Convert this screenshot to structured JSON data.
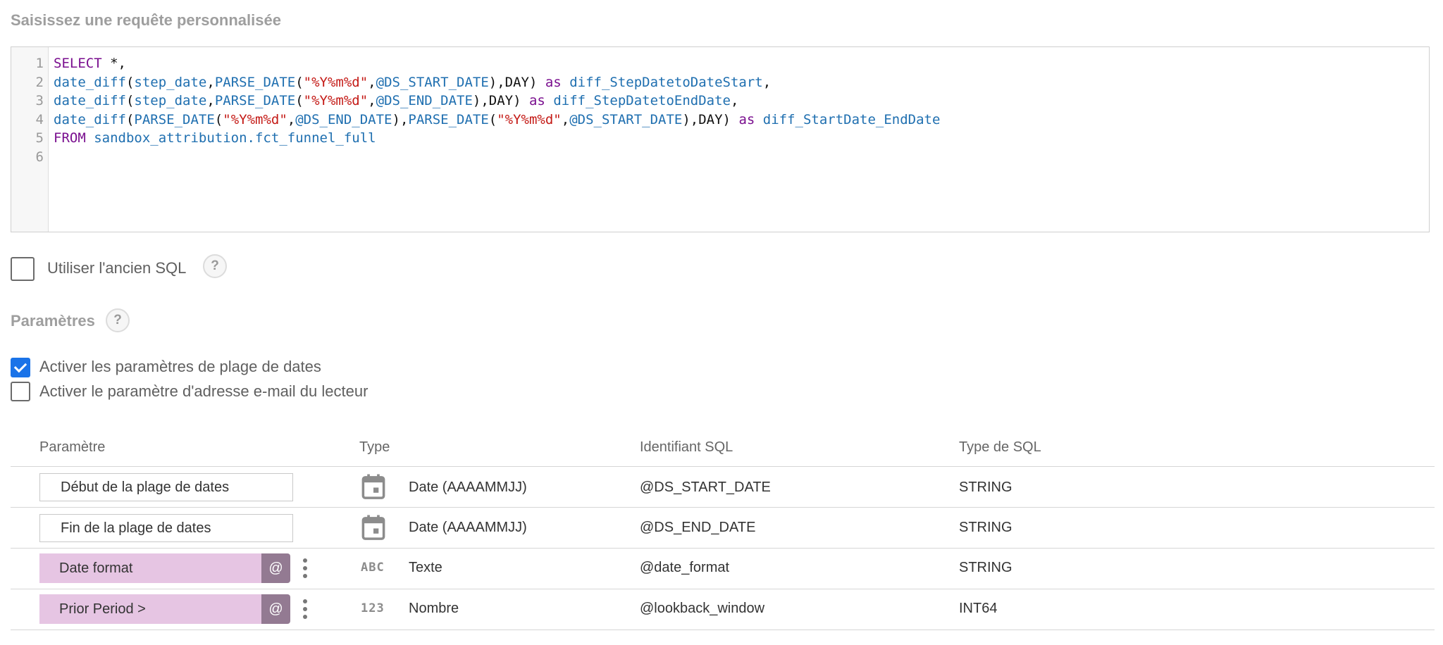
{
  "editor": {
    "title": "Saisissez une requête personnalisée",
    "lines": [
      {
        "num": "1",
        "segments": [
          {
            "t": "SELECT",
            "c": "kw"
          },
          {
            "t": " *,",
            "c": "pl"
          }
        ]
      },
      {
        "num": "2",
        "segments": [
          {
            "t": "date_diff",
            "c": "fn"
          },
          {
            "t": "(",
            "c": "pl"
          },
          {
            "t": "step_date",
            "c": "fn"
          },
          {
            "t": ",",
            "c": "pl"
          },
          {
            "t": "PARSE_DATE",
            "c": "fn"
          },
          {
            "t": "(",
            "c": "pl"
          },
          {
            "t": "\"%Y%m%d\"",
            "c": "st"
          },
          {
            "t": ",",
            "c": "pl"
          },
          {
            "t": "@DS_START_DATE",
            "c": "fn"
          },
          {
            "t": "),DAY) ",
            "c": "pl"
          },
          {
            "t": "as",
            "c": "kw"
          },
          {
            "t": " ",
            "c": "pl"
          },
          {
            "t": "diff_StepDatetoDateStart",
            "c": "fn"
          },
          {
            "t": ",",
            "c": "pl"
          }
        ]
      },
      {
        "num": "3",
        "segments": [
          {
            "t": "date_diff",
            "c": "fn"
          },
          {
            "t": "(",
            "c": "pl"
          },
          {
            "t": "step_date",
            "c": "fn"
          },
          {
            "t": ",",
            "c": "pl"
          },
          {
            "t": "PARSE_DATE",
            "c": "fn"
          },
          {
            "t": "(",
            "c": "pl"
          },
          {
            "t": "\"%Y%m%d\"",
            "c": "st"
          },
          {
            "t": ",",
            "c": "pl"
          },
          {
            "t": "@DS_END_DATE",
            "c": "fn"
          },
          {
            "t": "),DAY) ",
            "c": "pl"
          },
          {
            "t": "as",
            "c": "kw"
          },
          {
            "t": " ",
            "c": "pl"
          },
          {
            "t": "diff_StepDatetoEndDate",
            "c": "fn"
          },
          {
            "t": ",",
            "c": "pl"
          }
        ]
      },
      {
        "num": "4",
        "segments": [
          {
            "t": "date_diff",
            "c": "fn"
          },
          {
            "t": "(",
            "c": "pl"
          },
          {
            "t": "PARSE_DATE",
            "c": "fn"
          },
          {
            "t": "(",
            "c": "pl"
          },
          {
            "t": "\"%Y%m%d\"",
            "c": "st"
          },
          {
            "t": ",",
            "c": "pl"
          },
          {
            "t": "@DS_END_DATE",
            "c": "fn"
          },
          {
            "t": "),",
            "c": "pl"
          },
          {
            "t": "PARSE_DATE",
            "c": "fn"
          },
          {
            "t": "(",
            "c": "pl"
          },
          {
            "t": "\"%Y%m%d\"",
            "c": "st"
          },
          {
            "t": ",",
            "c": "pl"
          },
          {
            "t": "@DS_START_DATE",
            "c": "fn"
          },
          {
            "t": "),DAY) ",
            "c": "pl"
          },
          {
            "t": "as",
            "c": "kw"
          },
          {
            "t": " ",
            "c": "pl"
          },
          {
            "t": "diff_StartDate_EndDate",
            "c": "fn"
          }
        ]
      },
      {
        "num": "5",
        "segments": [
          {
            "t": "FROM",
            "c": "kw"
          },
          {
            "t": " ",
            "c": "pl"
          },
          {
            "t": "sandbox_attribution.fct_funnel_full",
            "c": "fn"
          }
        ]
      },
      {
        "num": "6",
        "segments": []
      }
    ]
  },
  "legacy_sql": {
    "label": "Utiliser l'ancien SQL",
    "checked": false,
    "help": "?"
  },
  "parameters": {
    "heading": "Paramètres",
    "help": "?",
    "date_range": {
      "label": "Activer les paramètres de plage de dates",
      "checked": true
    },
    "viewer_email": {
      "label": "Activer le paramètre d'adresse e-mail du lecteur",
      "checked": false
    }
  },
  "table": {
    "headers": {
      "param": "Paramètre",
      "type": "Type",
      "sql_id": "Identifiant SQL",
      "sql_type": "Type de SQL"
    },
    "rows": [
      {
        "name": "Début de la plage de dates",
        "style": "box",
        "type_icon": "calendar-icon",
        "type": "Date (AAAAMMJJ)",
        "sql_id": "@DS_START_DATE",
        "sql_type": "STRING"
      },
      {
        "name": "Fin de la plage de dates",
        "style": "box",
        "type_icon": "calendar-icon",
        "type": "Date (AAAAMMJJ)",
        "sql_id": "@DS_END_DATE",
        "sql_type": "STRING"
      },
      {
        "name": "Date format",
        "style": "pill",
        "at": "@",
        "type_icon": "text-type-icon",
        "icon_text": "ABC",
        "type": "Texte",
        "sql_id": "@date_format",
        "sql_type": "STRING"
      },
      {
        "name": "Prior Period >",
        "style": "pill",
        "at": "@",
        "type_icon": "number-type-icon",
        "icon_text": "123",
        "type": "Nombre",
        "sql_id": "@lookback_window",
        "sql_type": "INT64"
      }
    ]
  },
  "colors": {
    "keyword": "#7a0f8f",
    "function": "#1f6fb0",
    "string": "#c41a16",
    "checkbox_checked": "#1a73e8",
    "param_pill": "#e6c5e3",
    "param_at": "#937a92"
  }
}
